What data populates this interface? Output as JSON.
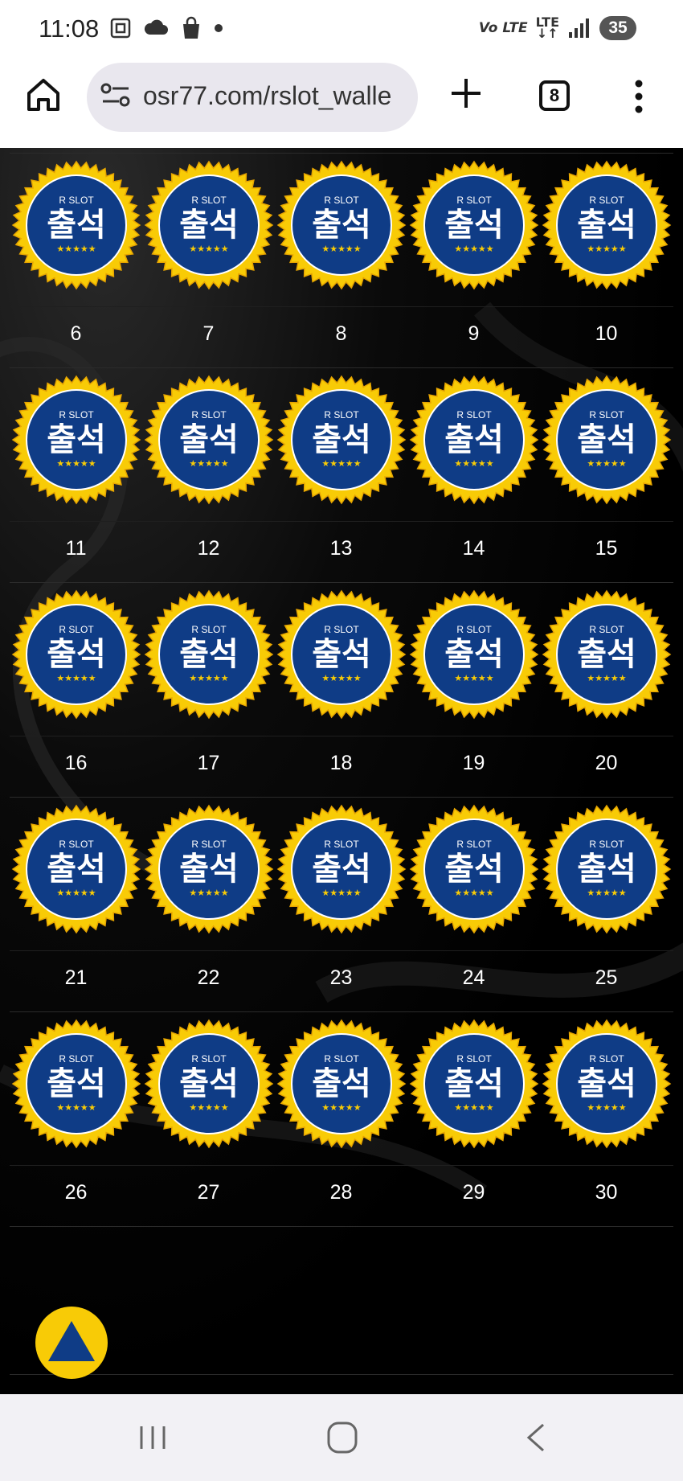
{
  "status": {
    "time": "11:08",
    "lte_label": "Vo LTE",
    "lte2_label": "LTE",
    "battery": "35"
  },
  "browser": {
    "url": "osr77.com/rslot_walle",
    "tab_count": "8"
  },
  "badge": {
    "brand": "R SLOT",
    "label": "출석",
    "stars": "★★★★★"
  },
  "grid": {
    "days": [
      "",
      "6",
      "7",
      "8",
      "9",
      "10",
      "11",
      "12",
      "13",
      "14",
      "15",
      "16",
      "17",
      "18",
      "19",
      "20",
      "21",
      "22",
      "23",
      "24",
      "25",
      "26",
      "27",
      "28",
      "29",
      "30"
    ]
  },
  "colors": {
    "badge_gold": "#f8cb06",
    "badge_navy": "#0f3c86",
    "background": "#000000"
  }
}
